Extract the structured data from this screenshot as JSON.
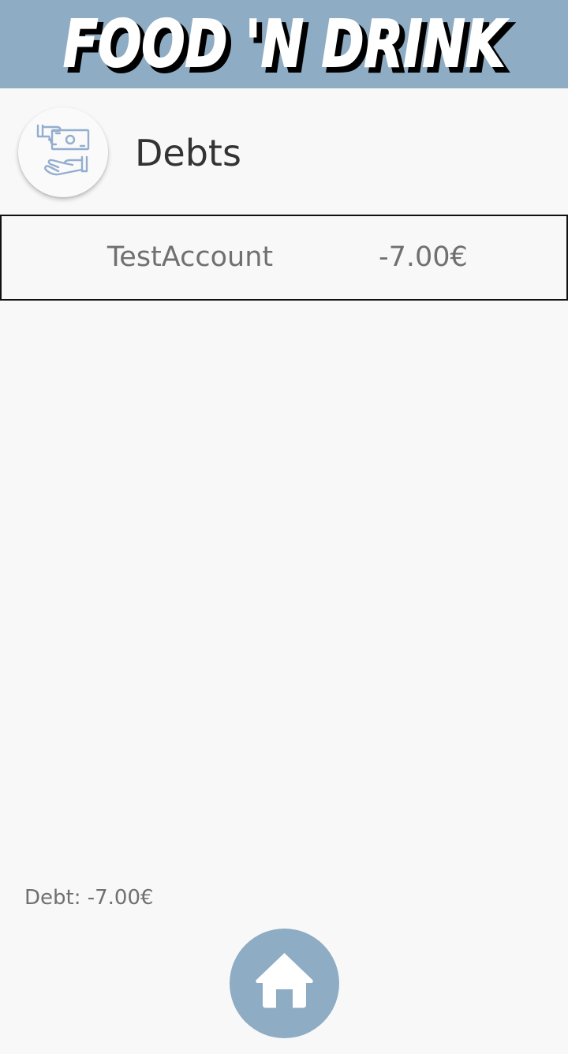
{
  "app": {
    "brand": "FOOD 'N DRINK",
    "accent_color": "#8eacc3"
  },
  "header": {
    "icon": "hand-money-icon",
    "title": "Debts"
  },
  "debts": [
    {
      "account": "TestAccount",
      "amount": "-7.00€"
    }
  ],
  "footer": {
    "total_debt": "Debt: -7.00€",
    "home_icon": "home-icon"
  }
}
